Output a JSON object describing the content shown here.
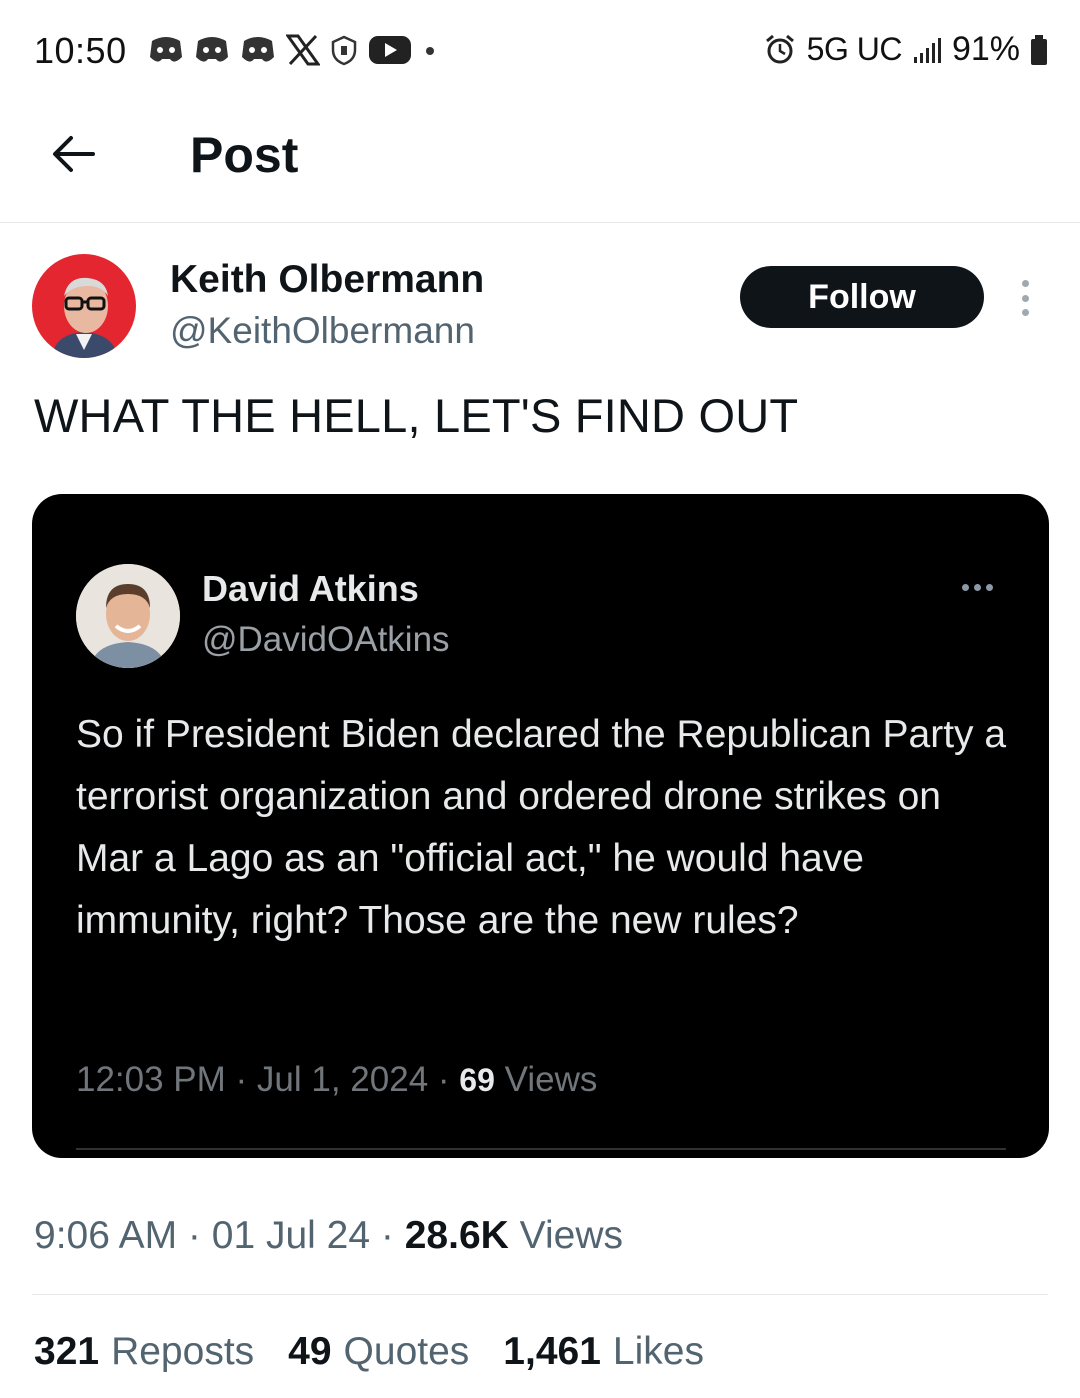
{
  "status_bar": {
    "time": "10:50",
    "network": "5G UC",
    "battery": "91%",
    "notification_icons": [
      "discord-icon",
      "discord-icon",
      "discord-icon",
      "x-icon",
      "shield-icon",
      "youtube-icon",
      "dot-icon"
    ],
    "right_icons": [
      "alarm-icon",
      "signal-icon",
      "battery-icon"
    ]
  },
  "header": {
    "title": "Post",
    "back_icon": "arrow-left-icon"
  },
  "post": {
    "author_name": "Keith Olbermann",
    "author_handle": "@KeithOlbermann",
    "follow_label": "Follow",
    "text": "WHAT THE HELL, LET'S FIND OUT",
    "time": "9:06 AM",
    "date": "01 Jul 24",
    "views_count": "28.6K",
    "views_label": "Views"
  },
  "quoted": {
    "author_name": "David Atkins",
    "author_handle": "@DavidOAtkins",
    "text": "So if President Biden declared the Republican Party a terrorist organization and ordered drone strikes on Mar a Lago as an \"official act,\" he would have immunity, right? Those are the new rules?",
    "time": "12:03 PM",
    "date": "Jul 1, 2024",
    "views_count": "69",
    "views_label": "Views"
  },
  "stats": {
    "reposts_count": "321",
    "reposts_label": "Reposts",
    "quotes_count": "49",
    "quotes_label": "Quotes",
    "likes_count": "1,461",
    "likes_label": "Likes"
  },
  "colors": {
    "text_primary": "#0f1419",
    "text_secondary": "#536471",
    "follow_bg": "#0f1419",
    "quote_bg": "#000000",
    "avatar_bg": "#e3262f"
  }
}
